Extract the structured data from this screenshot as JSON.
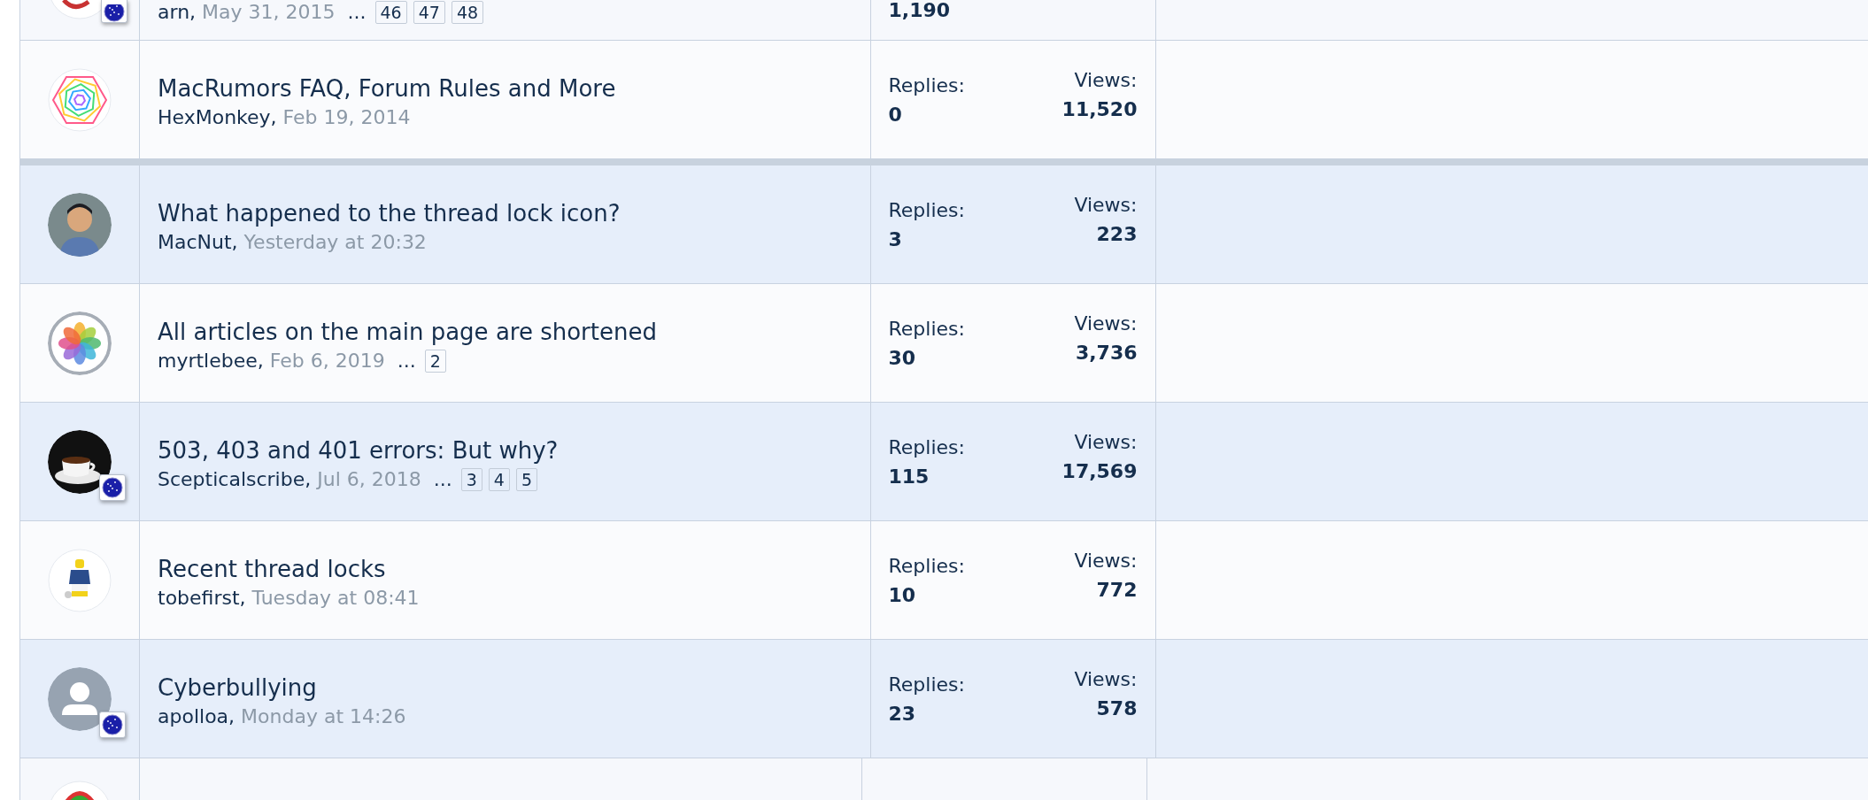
{
  "thread_above": {
    "author": "arn,",
    "date": "May 31, 2015",
    "ellipsis": "...",
    "pages": [
      "46",
      "47",
      "48"
    ],
    "replies": "1,190",
    "avatar": {
      "kind": "red"
    },
    "badge": true
  },
  "sticky_threads": [
    {
      "title": "MacRumors FAQ, Forum Rules and More",
      "author": "HexMonkey,",
      "date": "Feb 19, 2014",
      "replies_label": "Replies:",
      "replies": "0",
      "views_label": "Views:",
      "views": "11,520",
      "avatar": {
        "kind": "hexagon"
      },
      "badge": false,
      "highlighted": false
    }
  ],
  "threads": [
    {
      "title": "What happened to the thread lock icon?",
      "author": "MacNut,",
      "date": "Yesterday at 20:32",
      "replies_label": "Replies:",
      "replies": "3",
      "views_label": "Views:",
      "views": "223",
      "avatar": {
        "kind": "person"
      },
      "badge": false,
      "highlighted": true
    },
    {
      "title": "All articles on the main page are shortened",
      "author": "myrtlebee,",
      "date": "Feb 6, 2019",
      "ellipsis": "...",
      "pages": [
        "2"
      ],
      "replies_label": "Replies:",
      "replies": "30",
      "views_label": "Views:",
      "views": "3,736",
      "avatar": {
        "kind": "flower"
      },
      "badge": false,
      "highlighted": false
    },
    {
      "title": "503, 403 and 401 errors: But why?",
      "author": "Scepticalscribe,",
      "date": "Jul 6, 2018",
      "ellipsis": "...",
      "pages": [
        "3",
        "4",
        "5"
      ],
      "replies_label": "Replies:",
      "replies": "115",
      "views_label": "Views:",
      "views": "17,569",
      "avatar": {
        "kind": "coffee"
      },
      "badge": true,
      "highlighted": true
    },
    {
      "title": "Recent thread locks",
      "author": "tobefirst,",
      "date": "Tuesday at 08:41",
      "replies_label": "Replies:",
      "replies": "10",
      "views_label": "Views:",
      "views": "772",
      "avatar": {
        "kind": "figure"
      },
      "badge": false,
      "highlighted": false
    },
    {
      "title": "Cyberbullying",
      "author": "apolloa,",
      "date": "Monday at 14:26",
      "replies_label": "Replies:",
      "replies": "23",
      "views_label": "Views:",
      "views": "578",
      "avatar": {
        "kind": "default"
      },
      "badge": true,
      "highlighted": true
    }
  ],
  "thread_below": {
    "avatar": {
      "kind": "rainbow"
    }
  }
}
